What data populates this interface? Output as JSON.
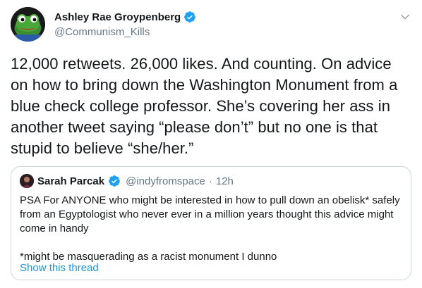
{
  "author": {
    "display_name": "Ashley Rae Groypenberg",
    "handle": "@Communism_Kills",
    "verified": true,
    "avatar_icon": "frog-avatar-icon"
  },
  "tweet": {
    "text": "12,000 retweets. 26,000 likes. And counting. On advice on how to bring down the Washington Monument from a blue check college professor. She’s covering her ass in another tweet saying “please don’t” but no one is that stupid to believe “she/her.”"
  },
  "quoted_tweet": {
    "display_name": "Sarah Parcak",
    "handle": "@indyfromspace",
    "separator": "·",
    "time": "12h",
    "verified": true,
    "text_line1": "PSA For ANYONE who might be interested in how to pull down an obelisk* safely from an Egyptologist who never ever in a million years thought this advice might come in handy",
    "text_line2": "*might be masquerading as a racist monument I dunno",
    "show_thread_label": "Show this thread"
  },
  "colors": {
    "link": "#1b95e0",
    "verified": "#1da1f2",
    "secondary_text": "#657786",
    "border": "#ccd6dd"
  }
}
